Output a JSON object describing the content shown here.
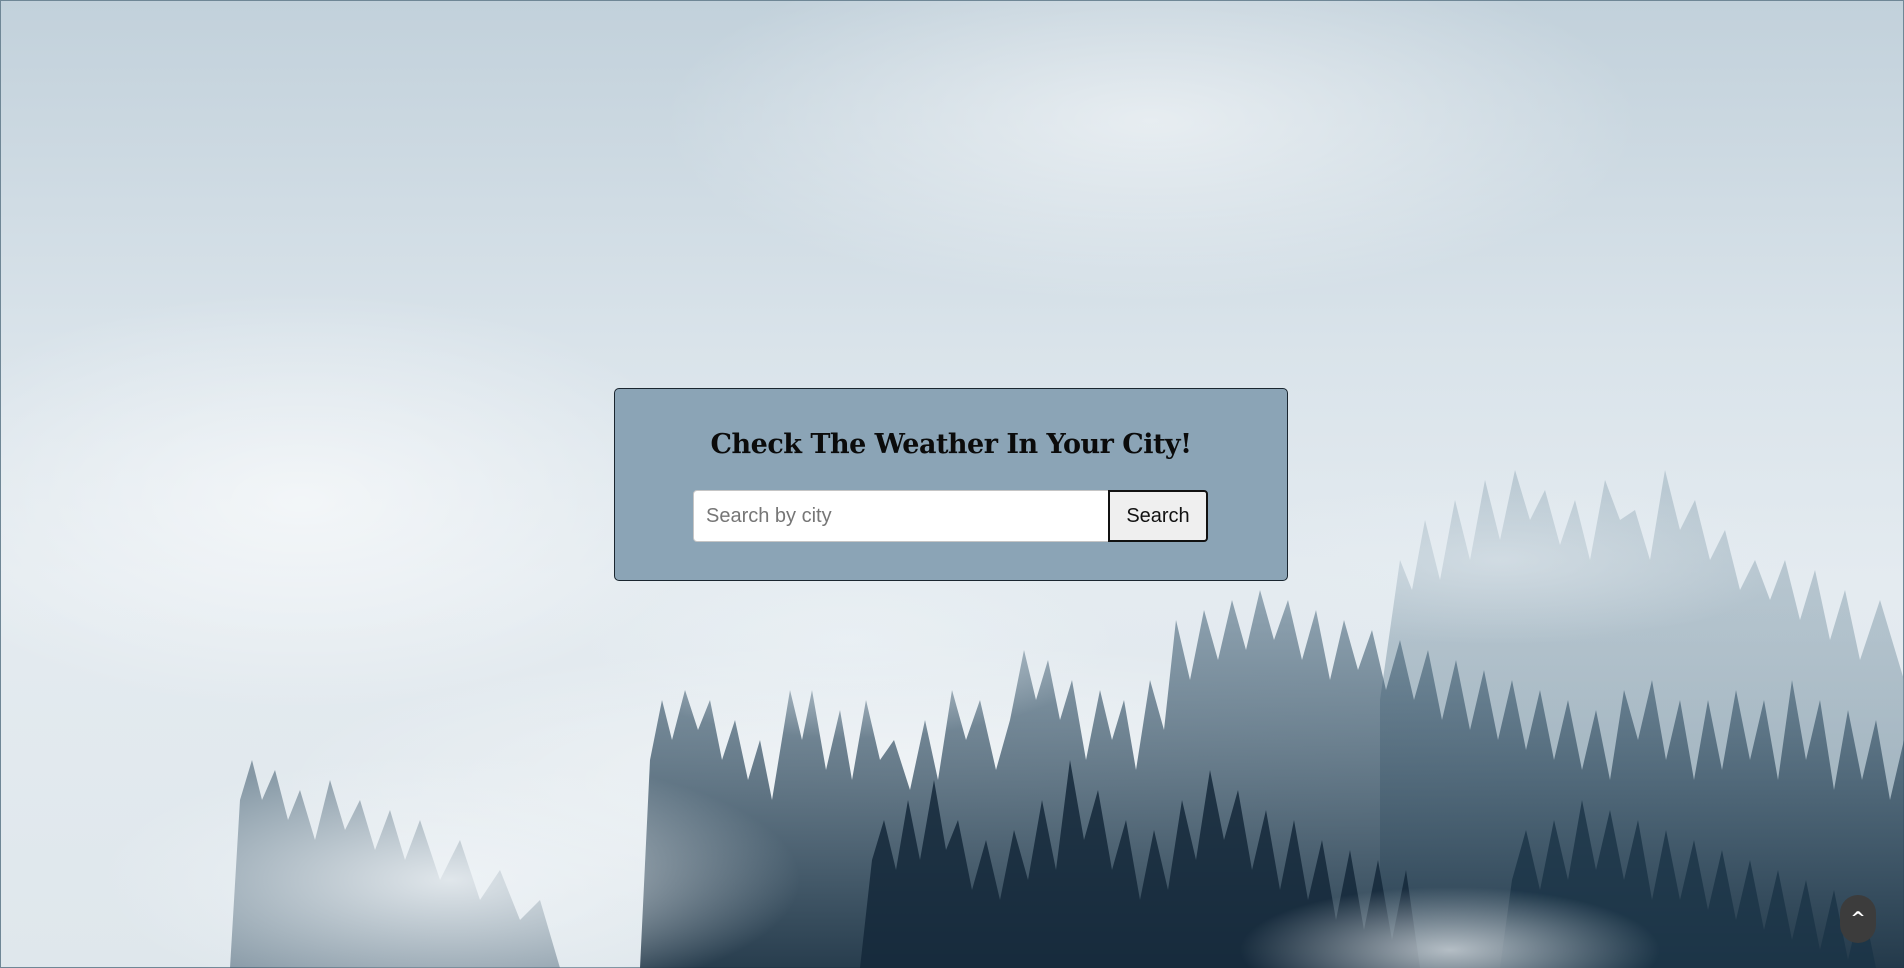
{
  "header": {
    "title": "Check The Weather In Your City!"
  },
  "search": {
    "placeholder": "Search by city",
    "value": "",
    "button_label": "Search"
  },
  "scroll_top": {
    "label": "^",
    "icon": "caret-up-icon"
  },
  "colors": {
    "card_background": "#8ba4b6",
    "card_border": "#1a2630",
    "scroll_button": "#3c3c3c"
  }
}
